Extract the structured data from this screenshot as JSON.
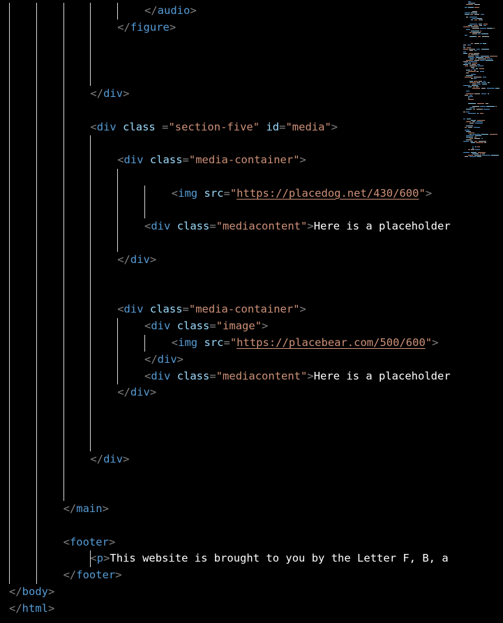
{
  "editor": {
    "lines": [
      {
        "indent": 5,
        "tokens": [
          {
            "t": "punct",
            "v": "</"
          },
          {
            "t": "tag",
            "v": "audio"
          },
          {
            "t": "punct",
            "v": ">"
          }
        ]
      },
      {
        "indent": 4,
        "tokens": [
          {
            "t": "punct",
            "v": "</"
          },
          {
            "t": "tag",
            "v": "figure"
          },
          {
            "t": "punct",
            "v": ">"
          }
        ]
      },
      {
        "indent": 0,
        "tokens": []
      },
      {
        "indent": 0,
        "tokens": []
      },
      {
        "indent": 0,
        "tokens": []
      },
      {
        "indent": 3,
        "tokens": [
          {
            "t": "punct",
            "v": "</"
          },
          {
            "t": "tag",
            "v": "div"
          },
          {
            "t": "punct",
            "v": ">"
          }
        ]
      },
      {
        "indent": 0,
        "tokens": []
      },
      {
        "indent": 3,
        "tokens": [
          {
            "t": "punct",
            "v": "<"
          },
          {
            "t": "tag",
            "v": "div"
          },
          {
            "t": "text",
            "v": " "
          },
          {
            "t": "attr",
            "v": "class"
          },
          {
            "t": "text",
            "v": " "
          },
          {
            "t": "punct",
            "v": "="
          },
          {
            "t": "string",
            "v": "\"section-five\""
          },
          {
            "t": "text",
            "v": " "
          },
          {
            "t": "attr",
            "v": "id"
          },
          {
            "t": "punct",
            "v": "="
          },
          {
            "t": "string",
            "v": "\"media\""
          },
          {
            "t": "punct",
            "v": ">"
          }
        ]
      },
      {
        "indent": 0,
        "tokens": []
      },
      {
        "indent": 4,
        "tokens": [
          {
            "t": "punct",
            "v": "<"
          },
          {
            "t": "tag",
            "v": "div"
          },
          {
            "t": "text",
            "v": " "
          },
          {
            "t": "attr",
            "v": "class"
          },
          {
            "t": "punct",
            "v": "="
          },
          {
            "t": "string",
            "v": "\"media-container\""
          },
          {
            "t": "punct",
            "v": ">"
          }
        ]
      },
      {
        "indent": 0,
        "tokens": []
      },
      {
        "indent": 6,
        "tokens": [
          {
            "t": "punct",
            "v": "<"
          },
          {
            "t": "tag",
            "v": "img"
          },
          {
            "t": "text",
            "v": " "
          },
          {
            "t": "attr",
            "v": "src"
          },
          {
            "t": "punct",
            "v": "="
          },
          {
            "t": "string",
            "v": "\""
          },
          {
            "t": "link",
            "v": "https://placedog.net/430/600"
          },
          {
            "t": "string",
            "v": "\""
          },
          {
            "t": "punct",
            "v": ">"
          }
        ]
      },
      {
        "indent": 0,
        "tokens": []
      },
      {
        "indent": 5,
        "tokens": [
          {
            "t": "punct",
            "v": "<"
          },
          {
            "t": "tag",
            "v": "div"
          },
          {
            "t": "text",
            "v": " "
          },
          {
            "t": "attr",
            "v": "class"
          },
          {
            "t": "punct",
            "v": "="
          },
          {
            "t": "string",
            "v": "\"mediacontent\""
          },
          {
            "t": "punct",
            "v": ">"
          },
          {
            "t": "text",
            "v": "Here is a placeholder"
          }
        ]
      },
      {
        "indent": 0,
        "tokens": []
      },
      {
        "indent": 4,
        "tokens": [
          {
            "t": "punct",
            "v": "</"
          },
          {
            "t": "tag",
            "v": "div"
          },
          {
            "t": "punct",
            "v": ">"
          }
        ]
      },
      {
        "indent": 0,
        "tokens": []
      },
      {
        "indent": 0,
        "tokens": []
      },
      {
        "indent": 4,
        "tokens": [
          {
            "t": "punct",
            "v": "<"
          },
          {
            "t": "tag",
            "v": "div"
          },
          {
            "t": "text",
            "v": " "
          },
          {
            "t": "attr",
            "v": "class"
          },
          {
            "t": "punct",
            "v": "="
          },
          {
            "t": "string",
            "v": "\"media-container\""
          },
          {
            "t": "punct",
            "v": ">"
          }
        ]
      },
      {
        "indent": 5,
        "tokens": [
          {
            "t": "punct",
            "v": "<"
          },
          {
            "t": "tag",
            "v": "div"
          },
          {
            "t": "text",
            "v": " "
          },
          {
            "t": "attr",
            "v": "class"
          },
          {
            "t": "punct",
            "v": "="
          },
          {
            "t": "string",
            "v": "\"image\""
          },
          {
            "t": "punct",
            "v": ">"
          }
        ]
      },
      {
        "indent": 6,
        "tokens": [
          {
            "t": "punct",
            "v": "<"
          },
          {
            "t": "tag",
            "v": "img"
          },
          {
            "t": "text",
            "v": " "
          },
          {
            "t": "attr",
            "v": "src"
          },
          {
            "t": "punct",
            "v": "="
          },
          {
            "t": "string",
            "v": "\""
          },
          {
            "t": "link",
            "v": "https://placebear.com/500/600"
          },
          {
            "t": "string",
            "v": "\""
          },
          {
            "t": "punct",
            "v": ">"
          }
        ]
      },
      {
        "indent": 5,
        "tokens": [
          {
            "t": "punct",
            "v": "</"
          },
          {
            "t": "tag",
            "v": "div"
          },
          {
            "t": "punct",
            "v": ">"
          }
        ]
      },
      {
        "indent": 5,
        "tokens": [
          {
            "t": "punct",
            "v": "<"
          },
          {
            "t": "tag",
            "v": "div"
          },
          {
            "t": "text",
            "v": " "
          },
          {
            "t": "attr",
            "v": "class"
          },
          {
            "t": "punct",
            "v": "="
          },
          {
            "t": "string",
            "v": "\"mediacontent\""
          },
          {
            "t": "punct",
            "v": ">"
          },
          {
            "t": "text",
            "v": "Here is a placeholder"
          }
        ]
      },
      {
        "indent": 4,
        "tokens": [
          {
            "t": "punct",
            "v": "</"
          },
          {
            "t": "tag",
            "v": "div"
          },
          {
            "t": "punct",
            "v": ">"
          }
        ]
      },
      {
        "indent": 0,
        "tokens": []
      },
      {
        "indent": 0,
        "tokens": []
      },
      {
        "indent": 0,
        "tokens": []
      },
      {
        "indent": 3,
        "tokens": [
          {
            "t": "punct",
            "v": "</"
          },
          {
            "t": "tag",
            "v": "div"
          },
          {
            "t": "punct",
            "v": ">"
          }
        ]
      },
      {
        "indent": 0,
        "tokens": []
      },
      {
        "indent": 0,
        "tokens": []
      },
      {
        "indent": 2,
        "tokens": [
          {
            "t": "punct",
            "v": "</"
          },
          {
            "t": "tag",
            "v": "main"
          },
          {
            "t": "punct",
            "v": ">"
          }
        ]
      },
      {
        "indent": 0,
        "tokens": []
      },
      {
        "indent": 2,
        "tokens": [
          {
            "t": "punct",
            "v": "<"
          },
          {
            "t": "tag",
            "v": "footer"
          },
          {
            "t": "punct",
            "v": ">"
          }
        ]
      },
      {
        "indent": 3,
        "tokens": [
          {
            "t": "punct",
            "v": "<"
          },
          {
            "t": "tag",
            "v": "p"
          },
          {
            "t": "punct",
            "v": ">"
          },
          {
            "t": "text",
            "v": "This website is brought to you by the Letter F, B, a"
          }
        ]
      },
      {
        "indent": 2,
        "tokens": [
          {
            "t": "punct",
            "v": "</"
          },
          {
            "t": "tag",
            "v": "footer"
          },
          {
            "t": "punct",
            "v": ">"
          }
        ]
      },
      {
        "indent": 0,
        "tokens": [
          {
            "t": "punct",
            "v": "</"
          },
          {
            "t": "tag",
            "v": "body"
          },
          {
            "t": "punct",
            "v": ">"
          }
        ]
      },
      {
        "indent": 0,
        "tokens": [
          {
            "t": "punct",
            "v": "</"
          },
          {
            "t": "tag",
            "v": "html"
          },
          {
            "t": "punct",
            "v": ">"
          }
        ]
      }
    ]
  },
  "colors": {
    "background": "#000000",
    "tag": "#569cd6",
    "bracket": "#808080",
    "attribute": "#9cdcfe",
    "string": "#ce9178",
    "text": "#ffffff",
    "indent_guide": "#d8d8d8"
  }
}
